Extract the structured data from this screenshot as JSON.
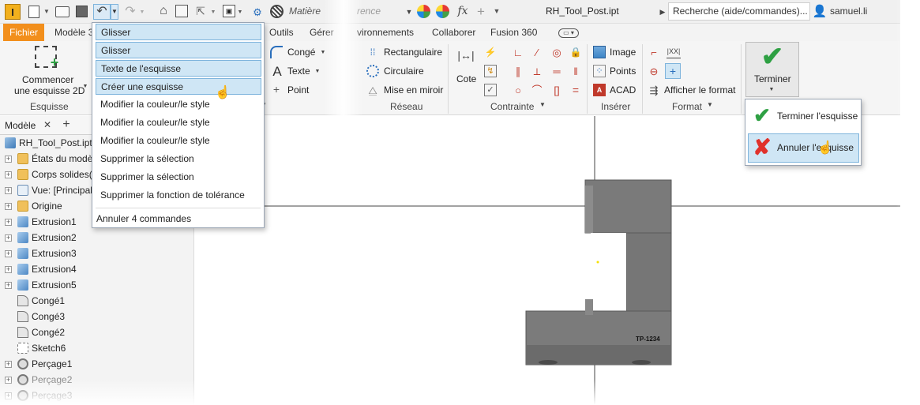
{
  "app": {
    "logo_letter": "I",
    "material_placeholder": "Matière",
    "appearance_placeholder": "rence",
    "document_title": "RH_Tool_Post.ipt",
    "help_search": "Recherche (aide/commandes)...",
    "username": "samuel.li"
  },
  "tabs": [
    "Fichier",
    "Modèle 3",
    "Outils",
    "Gérer",
    "vironnements",
    "Collaborer",
    "Fusion 360"
  ],
  "ribbon": {
    "sketch_button_line1": "Commencer",
    "sketch_button_line2": "une esquisse 2D",
    "sketch_group": "Esquisse",
    "conge": "Congé",
    "texte": "Texte",
    "point": "Point",
    "rectangulaire": "Rectangulaire",
    "circulaire": "Circulaire",
    "miroir": "Mise en miroir",
    "reseau_group": "Réseau",
    "cote": "Cote",
    "contrainte_group": "Contrainte",
    "image": "Image",
    "points": "Points",
    "acad": "ACAD",
    "inserer_group": "Insérer",
    "afficher_format": "Afficher le format",
    "format_group": "Format",
    "terminer": "Terminer"
  },
  "undo_menu": {
    "items": [
      "Glisser",
      "Glisser",
      "Texte de l'esquisse",
      "Créer une esquisse",
      "Modifier la couleur/le style",
      "Modifier la couleur/le style",
      "Modifier la couleur/le style",
      "Supprimer la sélection",
      "Supprimer la sélection",
      "Supprimer la fonction de tolérance"
    ],
    "selected_count": 4,
    "footer": "Annuler 4 commandes"
  },
  "finish_menu": {
    "items": [
      "Terminer l'esquisse",
      "Annuler l'esquisse"
    ]
  },
  "browser": {
    "tab_label": "Modèle",
    "rows": [
      {
        "label": "RH_Tool_Post.ipt",
        "icon": "part-icon"
      },
      {
        "label": "États du modè",
        "icon": "folder-icon"
      },
      {
        "label": "Corps solides(1",
        "icon": "folder-icon"
      },
      {
        "label": "Vue: [Principal",
        "icon": "view-icon"
      },
      {
        "label": "Origine",
        "icon": "folder-icon"
      },
      {
        "label": "Extrusion1",
        "icon": "extrusion-icon"
      },
      {
        "label": "Extrusion2",
        "icon": "extrusion-icon"
      },
      {
        "label": "Extrusion3",
        "icon": "extrusion-icon"
      },
      {
        "label": "Extrusion4",
        "icon": "extrusion-icon"
      },
      {
        "label": "Extrusion5",
        "icon": "extrusion-icon"
      },
      {
        "label": "Congé1",
        "icon": "fillet-icon"
      },
      {
        "label": "Congé3",
        "icon": "fillet-icon"
      },
      {
        "label": "Congé2",
        "icon": "fillet-icon"
      },
      {
        "label": "Sketch6",
        "icon": "sketch-icon"
      },
      {
        "label": "Perçage1",
        "icon": "hole-icon"
      },
      {
        "label": "Perçage2",
        "icon": "hole-icon"
      },
      {
        "label": "Perçage3",
        "icon": "hole-icon"
      }
    ]
  },
  "canvas": {
    "part_label": "TP-1234"
  },
  "colors": {
    "accent": "#f28f1c",
    "selection": "#cfe6f5",
    "check_green": "#2ea043",
    "cancel_red": "#e0312b",
    "part_gray": "#7d7d7d"
  }
}
